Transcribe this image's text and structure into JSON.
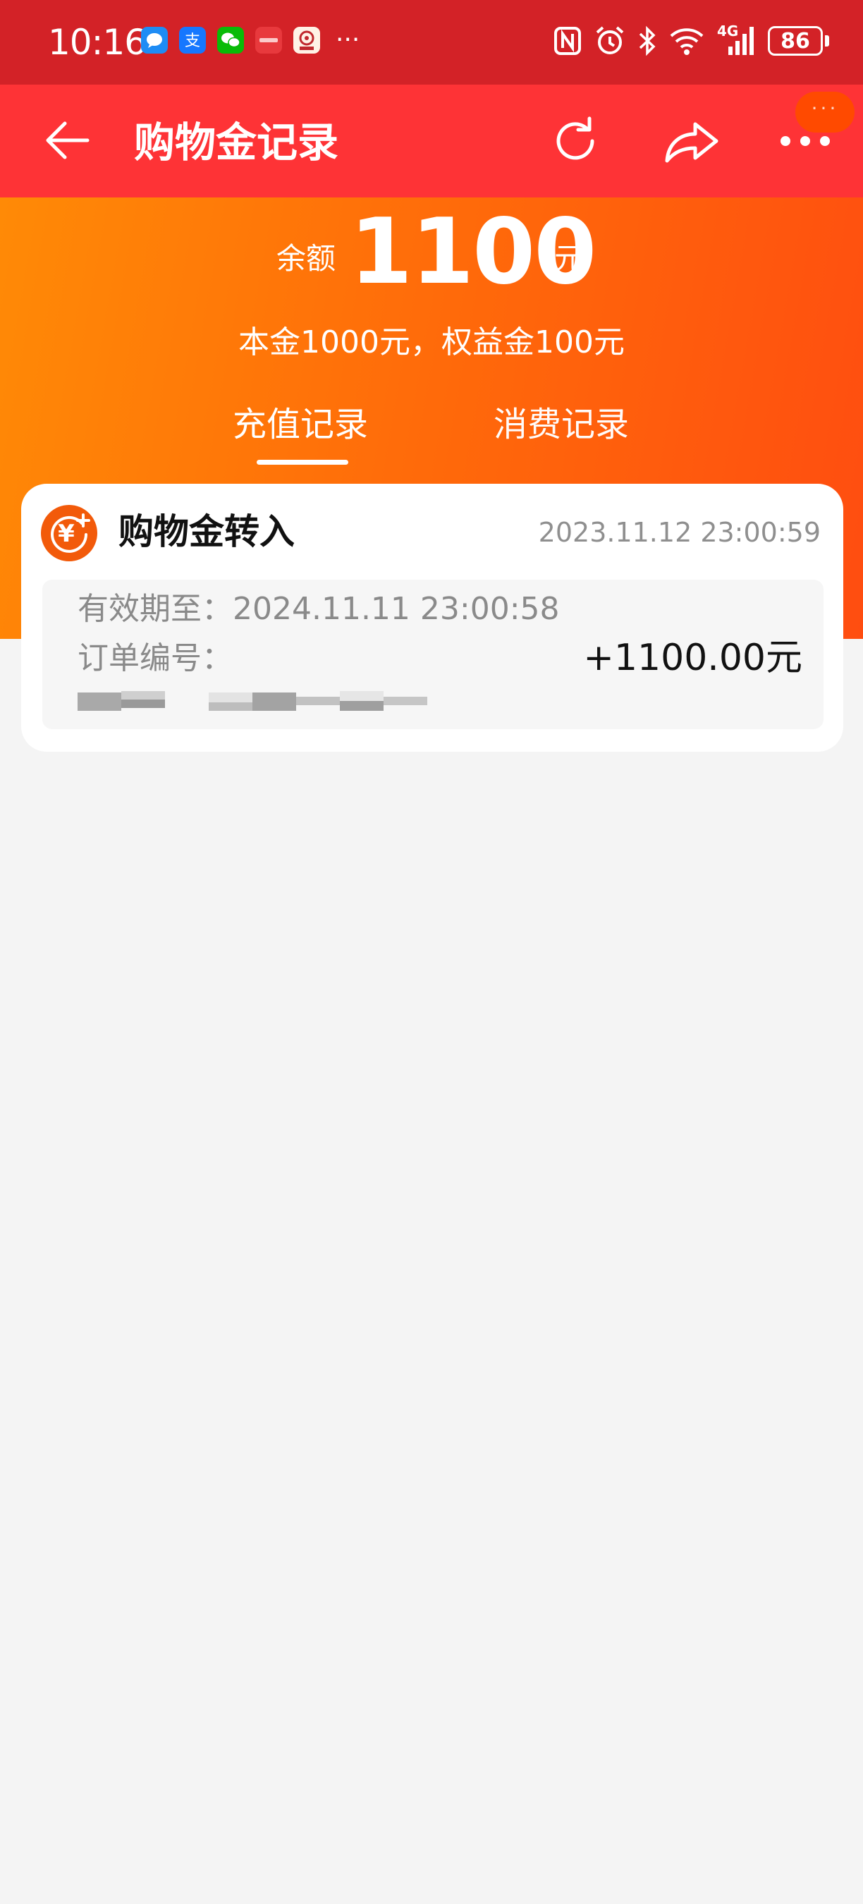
{
  "status_bar": {
    "time": "10:16",
    "overflow": "···",
    "battery": "86",
    "network": "4G"
  },
  "nav": {
    "title": "购物金记录",
    "badge": "···"
  },
  "balance": {
    "label": "余额",
    "value": "1100",
    "unit": "元",
    "breakdown": "本金1000元，权益金100元"
  },
  "tabs": [
    {
      "label": "充值记录",
      "selected": true
    },
    {
      "label": "消费记录",
      "selected": false
    }
  ],
  "records": [
    {
      "title": "购物金转入",
      "time": "2023.11.12 23:00:59",
      "expiry": "有效期至：2024.11.11 23:00:58",
      "order_label": "订单编号：",
      "amount": "+1100.00元"
    }
  ],
  "colors": {
    "status_bar": "#d32227",
    "nav_bar": "#fe3336",
    "gradient_start": "#ff8a06",
    "gradient_end": "#ff4d10",
    "page_bg": "#f4f4f4"
  }
}
